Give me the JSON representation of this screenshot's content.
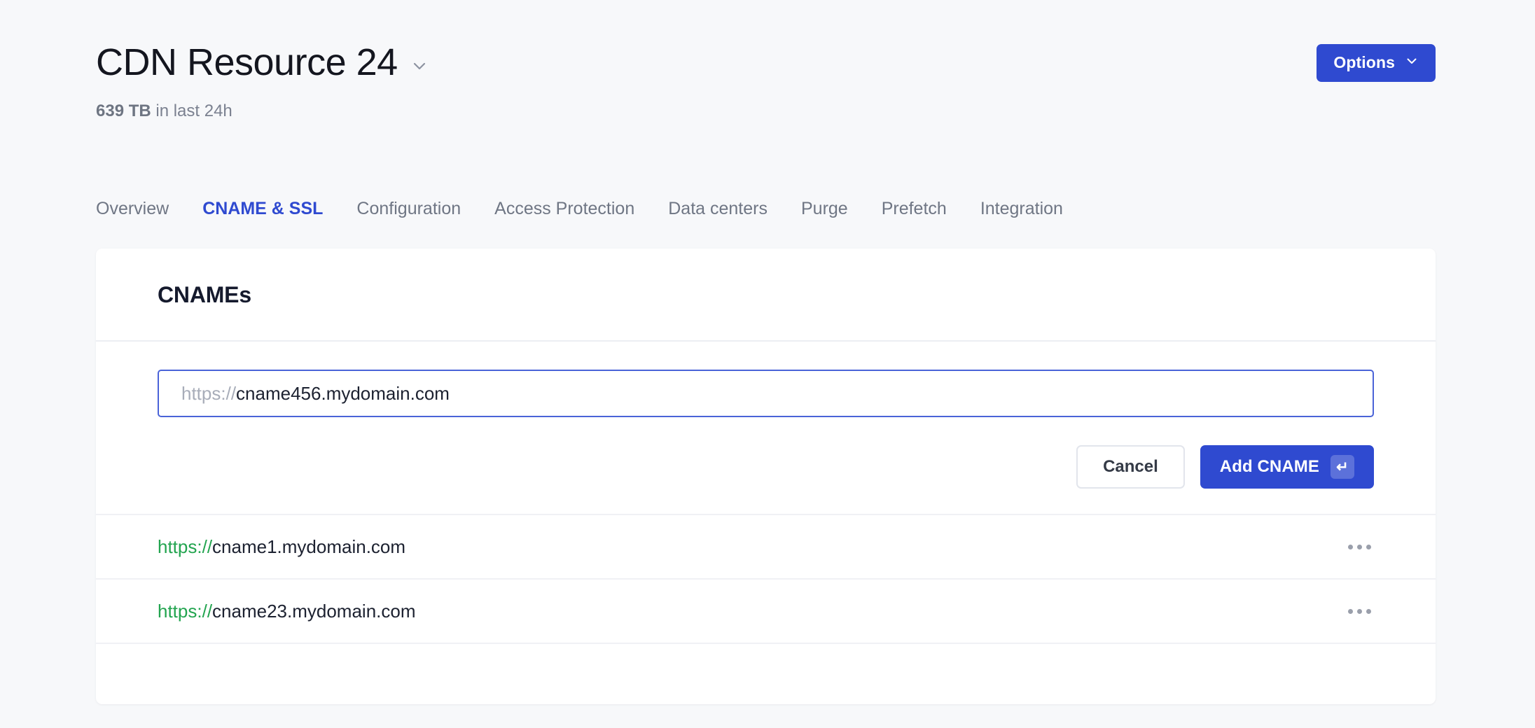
{
  "header": {
    "title": "CDN Resource 24",
    "title_chevron_icon": "chevron-down-icon",
    "subtitle_strong": "639 TB",
    "subtitle_rest": " in last 24h",
    "options_label": "Options",
    "options_chevron_icon": "chevron-down-icon",
    "accent_color": "#2f4ad0"
  },
  "tabs": [
    {
      "label": "Overview",
      "active": false
    },
    {
      "label": "CNAME & SSL",
      "active": true
    },
    {
      "label": "Configuration",
      "active": false
    },
    {
      "label": "Access Protection",
      "active": false
    },
    {
      "label": "Data centers",
      "active": false
    },
    {
      "label": "Purge",
      "active": false
    },
    {
      "label": "Prefetch",
      "active": false
    },
    {
      "label": "Integration",
      "active": false
    }
  ],
  "card": {
    "title": "CNAMEs",
    "input": {
      "prefix": "https://",
      "value": "cname456.mydomain.com",
      "placeholder": "cname456.mydomain.com",
      "focused": true,
      "border_color": "#4a63d8"
    },
    "cancel_label": "Cancel",
    "add_label": "Add CNAME",
    "add_shortcut_icon": "enter-key-icon",
    "add_shortcut_glyph": "↵",
    "rows": [
      {
        "scheme": "https://",
        "domain": "cname1.mydomain.com",
        "menu_icon": "more-horizontal-icon"
      },
      {
        "scheme": "https://",
        "domain": "cname23.mydomain.com",
        "menu_icon": "more-horizontal-icon"
      }
    ],
    "scheme_color": "#22a44f"
  }
}
